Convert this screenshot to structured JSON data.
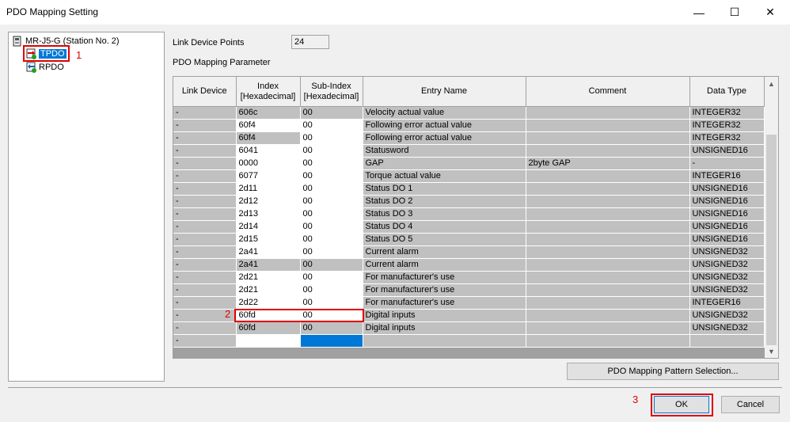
{
  "window": {
    "title": "PDO Mapping Setting",
    "minimize": "—",
    "maximize": "☐",
    "close": "✕"
  },
  "tree": {
    "root": "MR-J5-G (Station No. 2)",
    "tpdo": "TPDO",
    "rpdo": "RPDO"
  },
  "link_points": {
    "label": "Link Device Points",
    "value": "24"
  },
  "mapping": {
    "label": "PDO Mapping Parameter",
    "headers": [
      "Link Device",
      "Index\n[Hexadecimal]",
      "Sub-Index\n[Hexadecimal]",
      "Entry Name",
      "Comment",
      "Data Type"
    ],
    "rows": [
      [
        "-",
        "606c",
        "00",
        "Velocity actual value",
        "",
        "INTEGER32"
      ],
      [
        "-",
        "60f4",
        "00",
        "Following error actual value",
        "",
        "INTEGER32"
      ],
      [
        "-",
        "60f4",
        "00",
        "Following error actual value",
        "",
        "INTEGER32"
      ],
      [
        "-",
        "6041",
        "00",
        "Statusword",
        "",
        "UNSIGNED16"
      ],
      [
        "-",
        "0000",
        "00",
        "GAP",
        "2byte GAP",
        "-"
      ],
      [
        "-",
        "6077",
        "00",
        "Torque actual value",
        "",
        "INTEGER16"
      ],
      [
        "-",
        "2d11",
        "00",
        "Status DO 1",
        "",
        "UNSIGNED16"
      ],
      [
        "-",
        "2d12",
        "00",
        "Status DO 2",
        "",
        "UNSIGNED16"
      ],
      [
        "-",
        "2d13",
        "00",
        "Status DO 3",
        "",
        "UNSIGNED16"
      ],
      [
        "-",
        "2d14",
        "00",
        "Status DO 4",
        "",
        "UNSIGNED16"
      ],
      [
        "-",
        "2d15",
        "00",
        "Status DO 5",
        "",
        "UNSIGNED16"
      ],
      [
        "-",
        "2a41",
        "00",
        "Current alarm",
        "",
        "UNSIGNED32"
      ],
      [
        "-",
        "2a41",
        "00",
        "Current alarm",
        "",
        "UNSIGNED32"
      ],
      [
        "-",
        "2d21",
        "00",
        "For manufacturer's use",
        "",
        "UNSIGNED32"
      ],
      [
        "-",
        "2d21",
        "00",
        "For manufacturer's use",
        "",
        "UNSIGNED32"
      ],
      [
        "-",
        "2d22",
        "00",
        "For manufacturer's use",
        "",
        "INTEGER16"
      ],
      [
        "-",
        "60fd",
        "00",
        "Digital inputs",
        "",
        "UNSIGNED32"
      ],
      [
        "-",
        "60fd",
        "00",
        "Digital inputs",
        "",
        "UNSIGNED32"
      ],
      [
        "-",
        "",
        "",
        "",
        "",
        ""
      ]
    ],
    "white_cells": [
      [
        1,
        1
      ],
      [
        1,
        2
      ],
      [
        2,
        2
      ],
      [
        3,
        1
      ],
      [
        3,
        2
      ],
      [
        4,
        1
      ],
      [
        4,
        2
      ],
      [
        5,
        1
      ],
      [
        5,
        2
      ],
      [
        6,
        1
      ],
      [
        6,
        2
      ],
      [
        7,
        1
      ],
      [
        7,
        2
      ],
      [
        8,
        1
      ],
      [
        8,
        2
      ],
      [
        9,
        1
      ],
      [
        9,
        2
      ],
      [
        10,
        1
      ],
      [
        10,
        2
      ],
      [
        11,
        1
      ],
      [
        11,
        2
      ],
      [
        13,
        1
      ],
      [
        13,
        2
      ],
      [
        14,
        1
      ],
      [
        14,
        2
      ],
      [
        15,
        1
      ],
      [
        15,
        2
      ],
      [
        16,
        1
      ],
      [
        16,
        2
      ],
      [
        18,
        1
      ]
    ],
    "selected_cells": [
      [
        18,
        2
      ]
    ]
  },
  "buttons": {
    "pattern": "PDO Mapping Pattern Selection...",
    "ok": "OK",
    "cancel": "Cancel"
  },
  "annotations": [
    "1",
    "2",
    "3"
  ],
  "colors": {
    "highlight": "#0078d7",
    "annotation_red": "#e00000"
  }
}
